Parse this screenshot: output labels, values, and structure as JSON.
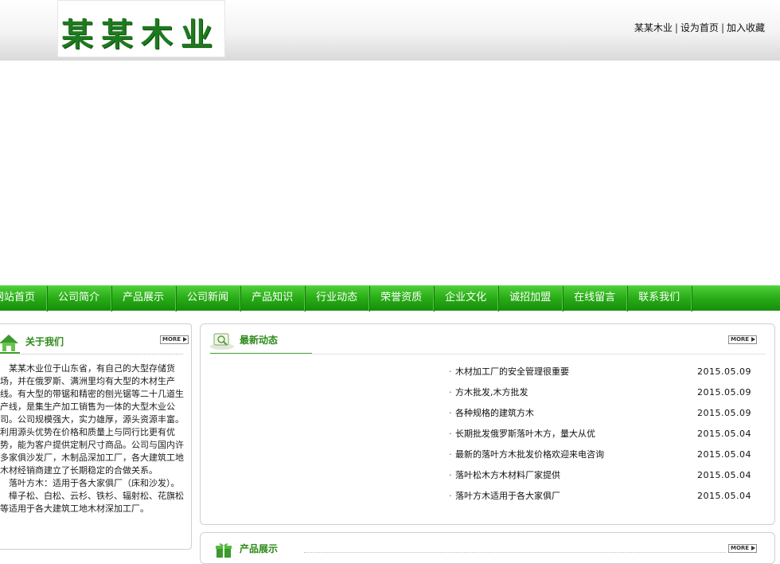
{
  "header": {
    "logo_text": "某某木业",
    "links": [
      {
        "label": "某某木业"
      },
      {
        "label": "设为首页"
      },
      {
        "label": "加入收藏"
      }
    ],
    "separator": "|"
  },
  "nav": {
    "items": [
      "网站首页",
      "公司简介",
      "产品展示",
      "公司新闻",
      "产品知识",
      "行业动态",
      "荣誉资质",
      "企业文化",
      "诚招加盟",
      "在线留言",
      "联系我们"
    ]
  },
  "about": {
    "title": "关于我们",
    "more_label": "MORE",
    "paragraphs": [
      "某某木业位于山东省，有自己的大型存储货场，并在俄罗斯、满洲里均有大型的木材生产线。有大型的带锯和精密的刨光锯等二十几道生产线，是集生产加工销售为一体的大型木业公司。公司规模强大，实力雄厚，源头资源丰富。利用源头优势在价格和质量上与同行比更有优势，能为客户提供定制尺寸商品。公司与国内许多家俱沙发厂，木制品深加工厂，各大建筑工地木材经销商建立了长期稳定的合做关系。",
      "落叶方木：适用于各大家俱厂（床和沙发）。",
      "樟子松、白松、云杉、铁杉、辐射松、花旗松等适用于各大建筑工地木材深加工厂。"
    ]
  },
  "news": {
    "title": "最新动态",
    "more_label": "MORE",
    "bullet": "·",
    "items": [
      {
        "title": "木材加工厂的安全管理很重要",
        "date": "2015.05.09"
      },
      {
        "title": "方木批发,木方批发",
        "date": "2015.05.09"
      },
      {
        "title": "各种规格的建筑方木",
        "date": "2015.05.09"
      },
      {
        "title": "长期批发俄罗斯落叶木方，量大从优",
        "date": "2015.05.04"
      },
      {
        "title": "最新的落叶方木批发价格欢迎来电咨询",
        "date": "2015.05.04"
      },
      {
        "title": "落叶松木方木材料厂家提供",
        "date": "2015.05.04"
      },
      {
        "title": "落叶方木适用于各大家俱厂",
        "date": "2015.05.04"
      }
    ]
  },
  "products": {
    "title": "产品展示",
    "more_label": "MORE"
  },
  "icons": {
    "about": "house-icon",
    "news": "news-icon",
    "products": "gift-icon",
    "more": "arrow-right-icon"
  },
  "colors": {
    "nav_green": "#28ab16",
    "title_green": "#2c8a18",
    "logo_green": "#1e7a1e"
  }
}
